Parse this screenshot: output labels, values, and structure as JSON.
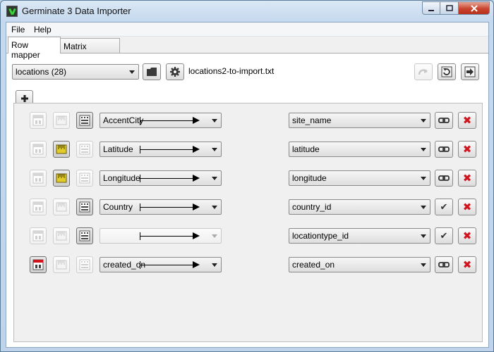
{
  "window": {
    "title": "Germinate 3 Data Importer"
  },
  "menu": [
    "File",
    "Help"
  ],
  "tabs": [
    "Row mapper",
    "Matrix mapper"
  ],
  "toolbar": {
    "table_select": "locations (28)",
    "filename": "locations2-to-import.txt"
  },
  "icons": {
    "open": "folder-icon",
    "settings": "gear-icon",
    "undo": "undo-icon",
    "refresh": "refresh-icon",
    "import": "import-icon",
    "add": "plus-icon",
    "date": "calendar-date-icon",
    "number": "ruler-icon",
    "text": "text-icon",
    "link": "link-icon",
    "check": "check-icon",
    "delete": "delete-icon"
  },
  "colors": {
    "delete": "#d2141e",
    "number_active": "#e2cc2a"
  },
  "mappings": [
    {
      "source": "AccentCity",
      "target": "site_name",
      "action": "link",
      "type": "text"
    },
    {
      "source": "Latitude",
      "target": "latitude",
      "action": "link",
      "type": "number"
    },
    {
      "source": "Longitude",
      "target": "longitude",
      "action": "link",
      "type": "number"
    },
    {
      "source": "Country",
      "target": "country_id",
      "action": "check",
      "type": "text"
    },
    {
      "source": "",
      "target": "locationtype_id",
      "action": "check",
      "type": "text"
    },
    {
      "source": "created_on",
      "target": "created_on",
      "action": "link",
      "type": "date"
    }
  ]
}
